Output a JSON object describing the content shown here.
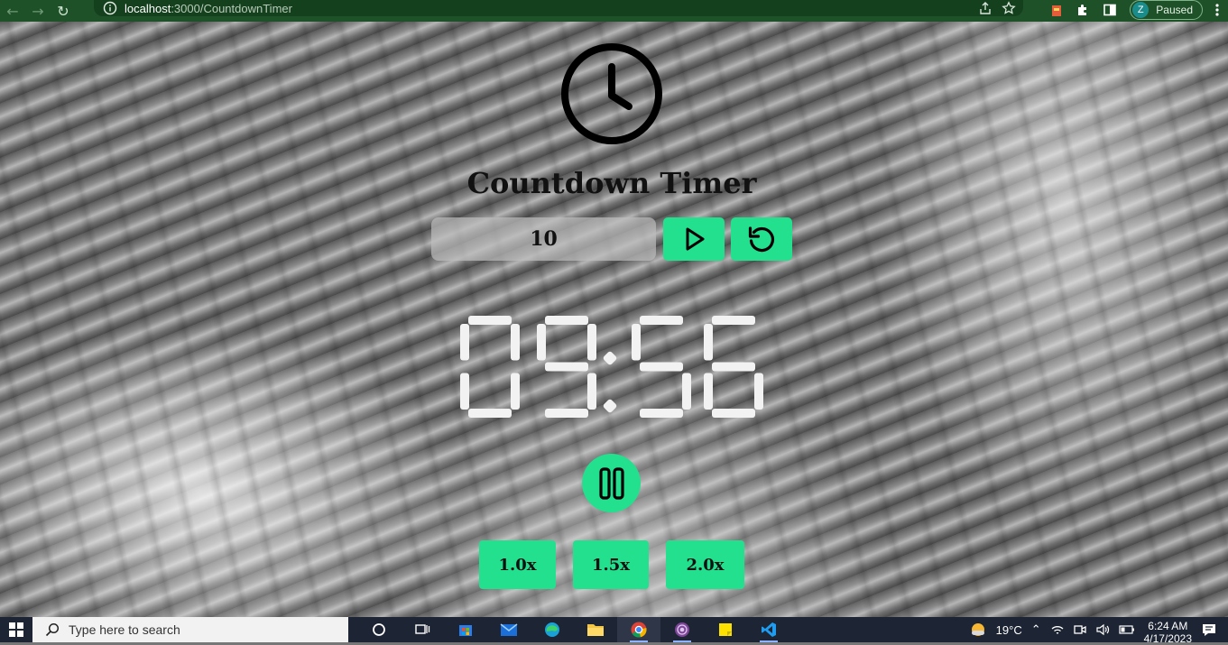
{
  "browser": {
    "url_host": "localhost",
    "url_path": ":3000/CountdownTimer",
    "profile_initial": "Z",
    "profile_status": "Paused"
  },
  "app": {
    "title": "Countdown Timer",
    "minutes_input_value": "10",
    "display": {
      "minutes": "09",
      "separator": ":",
      "seconds": "56"
    },
    "speed_options": [
      "1.0x",
      "1.5x",
      "2.0x"
    ],
    "accent_color": "#22e08d"
  },
  "taskbar": {
    "search_placeholder": "Type here to search",
    "temperature": "19°C",
    "time": "6:24 AM",
    "date": "4/17/2023"
  }
}
